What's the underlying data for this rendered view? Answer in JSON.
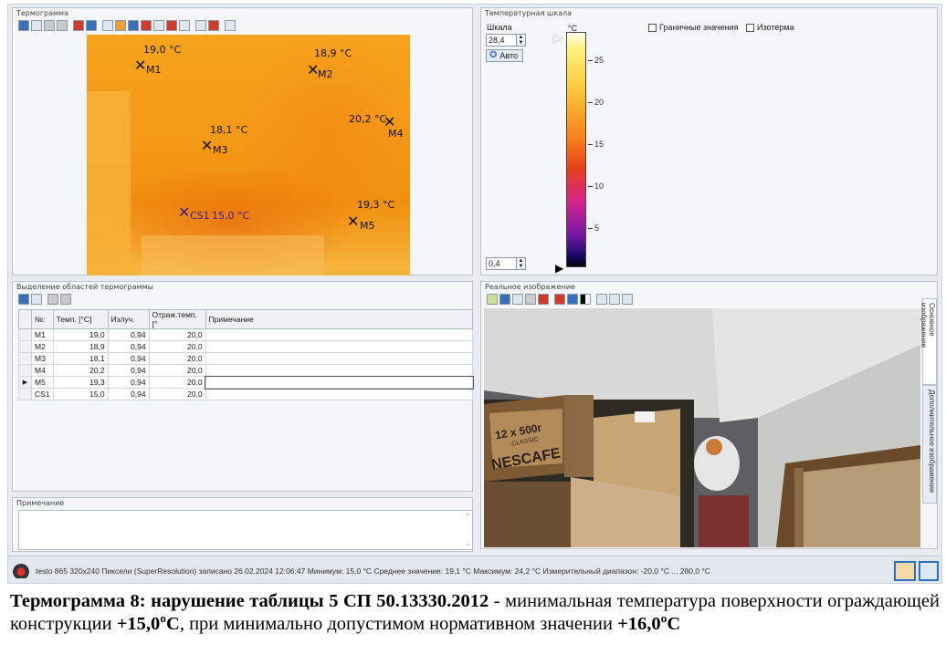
{
  "thermogram_panel": {
    "title": "Термограмма"
  },
  "markers": [
    {
      "name": "M1",
      "temp": "19,0 °C"
    },
    {
      "name": "M2",
      "temp": "18,9 °C"
    },
    {
      "name": "M4",
      "temp": "20,2 °C"
    },
    {
      "name": "M3",
      "temp": "18,1 °C"
    },
    {
      "name": "M5",
      "temp": "19,3 °C"
    },
    {
      "name": "CS1",
      "temp": "15,0 °C"
    }
  ],
  "scale_panel": {
    "title": "Температурная шкала",
    "scale_label": "Шкала",
    "max_value": "28,4",
    "min_value": "0,4",
    "auto_button": "Авто",
    "unit": "°C",
    "ticks": [
      "25",
      "20",
      "15",
      "10",
      "5"
    ],
    "checkbox_limits": "Граничные значения",
    "checkbox_isotherm": "Изотерма"
  },
  "regions_panel": {
    "title": "Выделение областей термограммы",
    "columns": [
      "№:",
      "Темп. [°C]",
      "Излуч.",
      "Отраж.темп. [°",
      "Примечание"
    ],
    "rows": [
      {
        "id": "M1",
        "temp": "19,0",
        "emis": "0,94",
        "refl": "20,0",
        "note": ""
      },
      {
        "id": "M2",
        "temp": "18,9",
        "emis": "0,94",
        "refl": "20,0",
        "note": ""
      },
      {
        "id": "M3",
        "temp": "18,1",
        "emis": "0,94",
        "refl": "20,0",
        "note": ""
      },
      {
        "id": "M4",
        "temp": "20,2",
        "emis": "0,94",
        "refl": "20,0",
        "note": ""
      },
      {
        "id": "M5",
        "temp": "19,3",
        "emis": "0,94",
        "refl": "20,0",
        "note": ""
      },
      {
        "id": "CS1",
        "temp": "15,0",
        "emis": "0,94",
        "refl": "20,0",
        "note": ""
      }
    ],
    "selected_row": 4
  },
  "note_panel": {
    "title": "Примечание"
  },
  "photo_panel": {
    "title": "Реальное изображение",
    "tab_main": "Основное изображение",
    "tab_extra": "Дополнительное изображение",
    "box_text_1": "12 x 500г",
    "box_text_2": "CLASSIC",
    "box_text_3": "NESCAFE"
  },
  "status_bar": {
    "text": "testo 865 320x240 Пиксели (SuperResolution) записано 26.02.2024 12:06:47  Минимум: 15,0 °C  Среднее значение: 19,1 °C  Максимум: 24,2 °C  Измерительный диапазон: -20,0 °C ... 280,0 °C"
  },
  "caption": {
    "bold_part": "Термограмма  8: нарушение таблицы 5 СП 50.13330.2012",
    "text_part_1": " - минимальная температура поверхности ограждающей конструкции ",
    "bold_value_1": "+15,0ºС",
    "text_part_2": ", при минимально допустимом нормативном значении ",
    "bold_value_2": "+16,0ºС"
  }
}
